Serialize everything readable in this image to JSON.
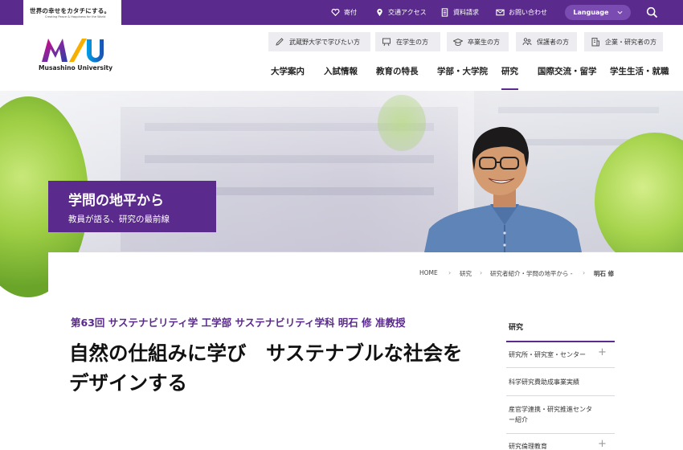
{
  "brand": {
    "tagline": "世界の幸せをカタチにする。",
    "subline": "Creating Peace & Happiness for the World",
    "university_name": "Musashino University"
  },
  "utility": {
    "donate": "寄付",
    "access": "交通アクセス",
    "brochure": "資料請求",
    "contact": "お問い合わせ",
    "language": "Language"
  },
  "audience": [
    {
      "label": "武蔵野大学で学びたい方",
      "icon": "pencil-icon"
    },
    {
      "label": "在学生の方",
      "icon": "board-icon"
    },
    {
      "label": "卒業生の方",
      "icon": "graduation-cap-icon"
    },
    {
      "label": "保護者の方",
      "icon": "people-icon"
    },
    {
      "label": "企業・研究者の方",
      "icon": "building-icon"
    }
  ],
  "nav": [
    "大学案内",
    "入試情報",
    "教育の特長",
    "学部・大学院",
    "研究",
    "国際交流・留学",
    "学生生活・就職"
  ],
  "hero": {
    "title": "学問の地平から",
    "subtitle": "教員が語る、研究の最前線"
  },
  "breadcrumb": [
    "HOME",
    "研究",
    "研究者紹介・学問の地平から -",
    "明石 修"
  ],
  "article": {
    "subhead": "第63回 サステナビリティ学 工学部 サステナビリティ学科 明石 修 准教授",
    "headline": "自然の仕組みに学び　サステナブルな社会をデザインする"
  },
  "side_menu": {
    "title": "研究",
    "items": [
      {
        "label": "研究所・研究室・センター",
        "expandable": "+"
      },
      {
        "label": "科学研究費助成事業実績"
      },
      {
        "label": "産官学連携・研究推進センター紹介"
      },
      {
        "label": "研究倫理教育",
        "expandable": "+"
      }
    ]
  },
  "colors": {
    "brand_purple": "#5a2a8c",
    "language_pill": "#7a4bb0"
  }
}
